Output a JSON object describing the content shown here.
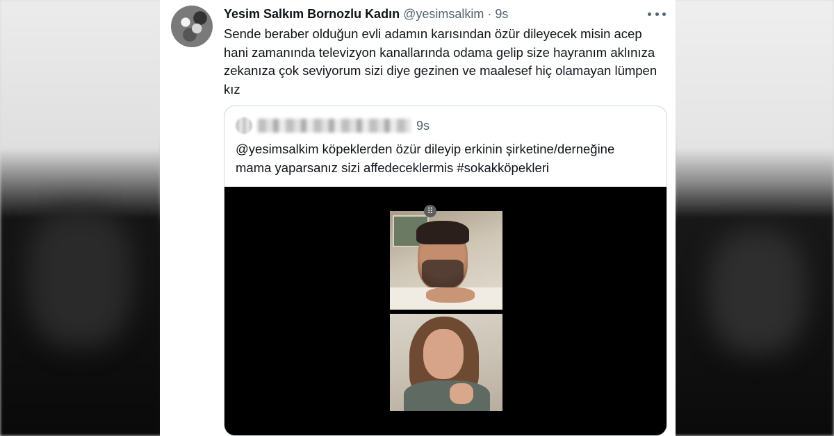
{
  "tweet": {
    "display_name": "Yesim Salkım Bornozlu Kadın",
    "handle": "@yesimsalkim",
    "separator": "·",
    "time": "9s",
    "text": "Sende beraber olduğun evli adamın karısından özür dileyecek misin acep hani zamanında televizyon kanallarında odama gelip size hayranım aklınıza zekanıza çok seviyorum sizi diye gezinen ve maalesef hiç olamayan lümpen kız"
  },
  "quote": {
    "time": "9s",
    "text": "@yesimsalkim köpeklerden özür dileyip  erkinin şirketine/derneğine mama yaparsanız sizi affedeceklermis #sokakköpekleri"
  },
  "icons": {
    "more": "more-icon",
    "grid": "grid-icon"
  },
  "colors": {
    "text_primary": "#0f1419",
    "text_secondary": "#536471",
    "border": "#cfd9de",
    "media_bg": "#000000"
  }
}
